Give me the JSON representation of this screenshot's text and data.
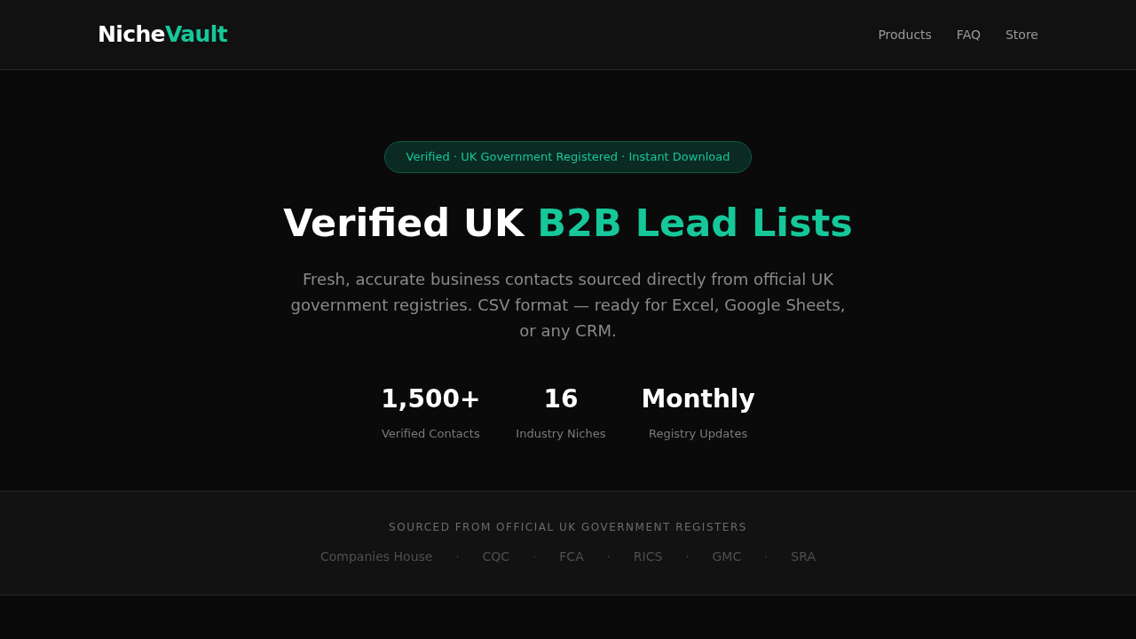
{
  "header": {
    "logo": {
      "part_1": "Niche",
      "part_2": "Vault"
    },
    "nav": [
      {
        "label": "Products"
      },
      {
        "label": "FAQ"
      },
      {
        "label": "Store"
      }
    ]
  },
  "hero": {
    "badge": "Verified · UK Government Registered · Instant Download",
    "title": {
      "plain": "Verified UK",
      "highlight": "B2B Lead Lists"
    },
    "subtitle": "Fresh, accurate business contacts sourced directly from official UK government registries. CSV format — ready for Excel, Google Sheets, or any CRM.",
    "stats": [
      {
        "value": "1,500+",
        "label": "Verified Contacts"
      },
      {
        "value": "16",
        "label": "Industry Niches"
      },
      {
        "value": "Monthly",
        "label": "Registry Updates"
      }
    ]
  },
  "sources": {
    "heading": "SOURCED FROM OFFICIAL UK GOVERNMENT REGISTERS",
    "registers": [
      "Companies House",
      "CQC",
      "FCA",
      "RICS",
      "GMC",
      "SRA"
    ],
    "separators": [
      "·",
      "·",
      "·",
      "·",
      "·"
    ]
  }
}
